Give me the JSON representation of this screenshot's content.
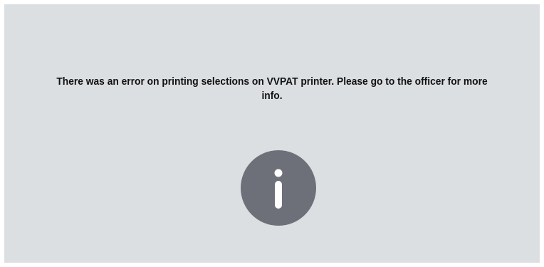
{
  "dialog": {
    "message": "There was an error on printing selections on VVPAT printer. Please go to the officer for more info.",
    "icon": "info-icon",
    "icon_color": "#6d7079",
    "background_color": "#dcdfe2"
  }
}
